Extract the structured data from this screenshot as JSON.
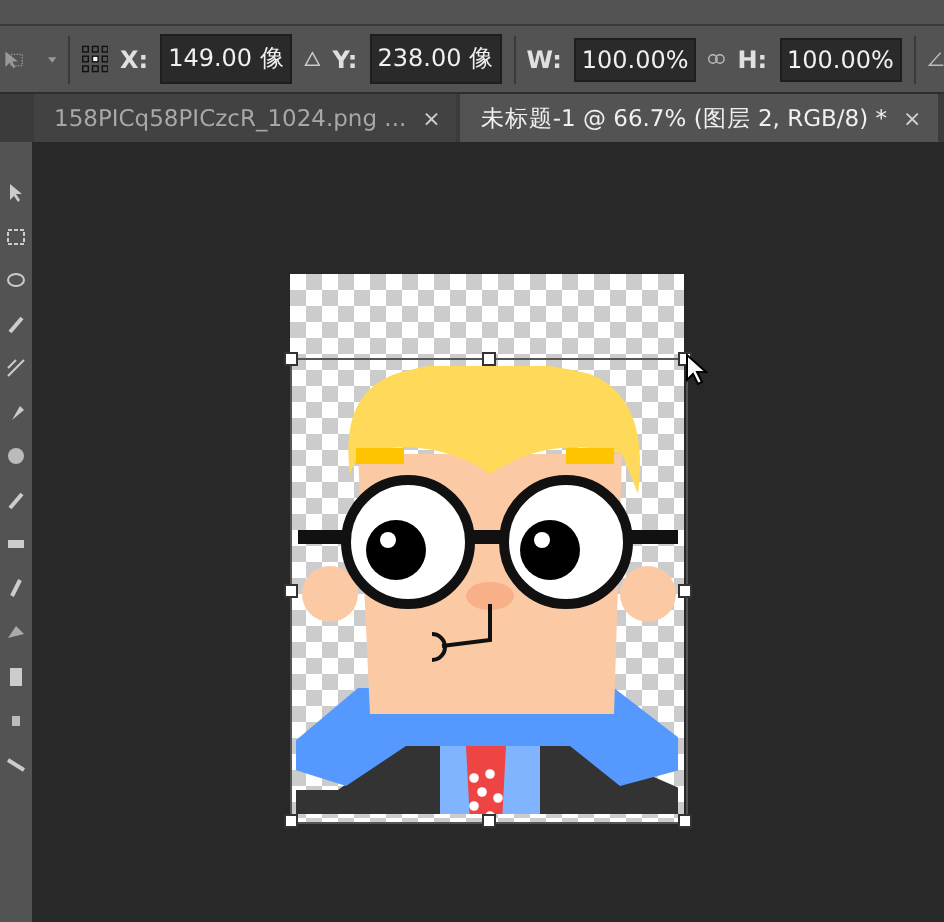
{
  "options_bar": {
    "fields": [
      {
        "label": "X:",
        "value": "149.00 像"
      },
      {
        "label": "Y:",
        "value": "238.00 像"
      },
      {
        "label": "W:",
        "value": "100.00%"
      },
      {
        "label": "H:",
        "value": "100.00%"
      }
    ]
  },
  "tabs": [
    {
      "label": "158PICq58PICzcR_1024.png ...",
      "close": "×",
      "selected": false
    },
    {
      "label": "未标题-1 @ 66.7% (图层 2, RGB/8) *",
      "close": "×",
      "selected": true
    }
  ]
}
